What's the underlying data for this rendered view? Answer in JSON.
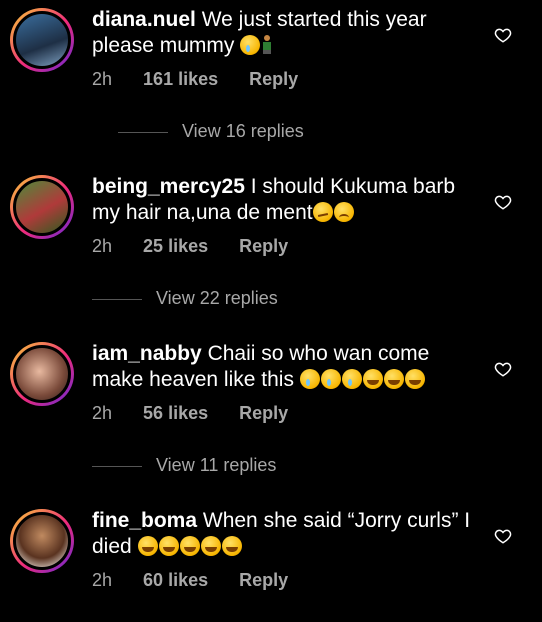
{
  "comments": [
    {
      "username": "diana.nuel",
      "text": "We just started this year please mummy",
      "emojis": [
        "sad",
        "person-kneeling"
      ],
      "time": "2h",
      "likes": "161 likes",
      "reply": "Reply",
      "view_replies": "View 16 replies"
    },
    {
      "username": "being_mercy25",
      "text": "I should Kukuma barb my hair na,una de ment",
      "emojis": [
        "smirk",
        "frown"
      ],
      "time": "2h",
      "likes": "25 likes",
      "reply": "Reply",
      "view_replies": "View 22 replies"
    },
    {
      "username": "iam_nabby",
      "text": "Chaii so who wan come make heaven like this",
      "emojis": [
        "sad",
        "sad",
        "sad",
        "laugh",
        "laugh",
        "laugh"
      ],
      "time": "2h",
      "likes": "56 likes",
      "reply": "Reply",
      "view_replies": "View 11 replies"
    },
    {
      "username": "fine_boma",
      "text": "When she said “Jorry curls” I died",
      "emojis": [
        "laugh",
        "laugh",
        "laugh",
        "laugh",
        "laugh"
      ],
      "time": "2h",
      "likes": "60 likes",
      "reply": "Reply"
    }
  ]
}
